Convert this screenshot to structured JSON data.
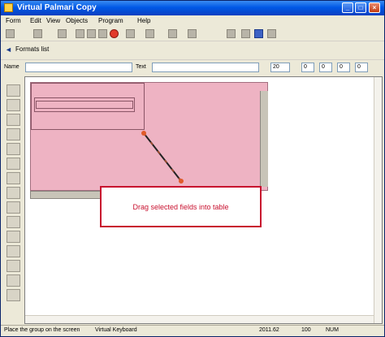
{
  "window": {
    "title": "Virtual Palmari Copy"
  },
  "menu": {
    "items": [
      "Form",
      "Edit",
      "View",
      "Objects",
      "Program",
      "Help"
    ]
  },
  "nav": {
    "label": "Formats list"
  },
  "props": {
    "name_label": "Name",
    "text_label": "Text",
    "fields": [
      "20",
      "0",
      "0",
      "0",
      "0"
    ]
  },
  "callout": {
    "text": "Drag selected fields into table"
  },
  "status": {
    "hint": "Place the group on the screen",
    "mode": "Virtual Keyboard",
    "coords": "2011.62",
    "zoom": "100",
    "extra": "NUM"
  },
  "colors": {
    "accent": "#c8102e",
    "selection": "#eeb3c3",
    "titlebar": "#0058e6"
  }
}
